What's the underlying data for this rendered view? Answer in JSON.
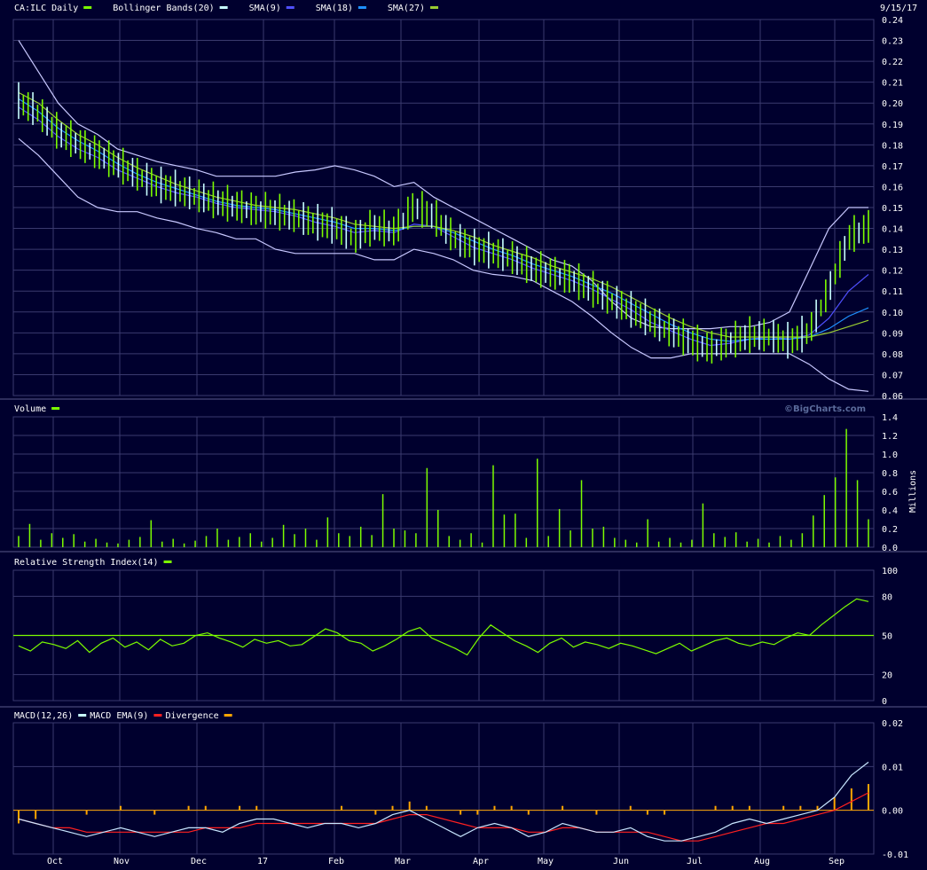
{
  "date_label": "9/15/17",
  "watermark": "©BigCharts.com",
  "colors": {
    "background": "#00002e",
    "grid": "#3a3a6e",
    "price_bar": "#7cfc00",
    "price_bar_alt": "#c8ffff",
    "bollinger": "#c8c8ff",
    "sma9": "#5050ff",
    "sma18": "#1e90ff",
    "sma27": "#9acd32",
    "volume": "#7cfc00",
    "rsi": "#7cfc00",
    "rsi_midline": "#7cfc00",
    "macd": "#c8e6ff",
    "macd_ema": "#ff2020",
    "divergence": "#ffa500"
  },
  "months": [
    "Oct",
    "Nov",
    "Dec",
    "17",
    "Feb",
    "Mar",
    "Apr",
    "May",
    "Jun",
    "Jul",
    "Aug",
    "Sep"
  ],
  "legends": {
    "price": [
      {
        "text": "CA:ILC Daily",
        "color": "#7cfc00"
      },
      {
        "text": "Bollinger Bands(20)",
        "color": "#c8ffff"
      },
      {
        "text": "SMA(9)",
        "color": "#5050ff"
      },
      {
        "text": "SMA(18)",
        "color": "#1e90ff"
      },
      {
        "text": "SMA(27)",
        "color": "#9acd32"
      }
    ],
    "volume": [
      {
        "text": "Volume",
        "color": "#7cfc00"
      }
    ],
    "rsi": [
      {
        "text": "Relative Strength Index(14)",
        "color": "#7cfc00"
      }
    ],
    "macd": [
      {
        "text": "MACD(12,26)",
        "color": "#c8ffff"
      },
      {
        "text": "MACD EMA(9)",
        "color": "#ff2020"
      },
      {
        "text": "Divergence",
        "color": "#ffa500"
      }
    ]
  },
  "chart_data": [
    {
      "type": "line",
      "panel": "price",
      "ylim": [
        0.06,
        0.24
      ],
      "yticks": [
        "0.24",
        "0.23",
        "0.22",
        "0.21",
        "0.20",
        "0.19",
        "0.18",
        "0.17",
        "0.16",
        "0.15",
        "0.14",
        "0.13",
        "0.12",
        "0.11",
        "0.10",
        "0.09",
        "0.08",
        "0.07",
        "0.06"
      ],
      "x_months": [
        "Oct",
        "Nov",
        "Dec",
        "17",
        "Feb",
        "Mar",
        "Apr",
        "May",
        "Jun",
        "Jul",
        "Aug",
        "Sep"
      ],
      "series": [
        {
          "name": "CA:ILC Daily",
          "role": "close",
          "values": [
            0.2,
            0.195,
            0.185,
            0.18,
            0.175,
            0.17,
            0.165,
            0.16,
            0.158,
            0.155,
            0.152,
            0.15,
            0.148,
            0.147,
            0.145,
            0.142,
            0.14,
            0.135,
            0.14,
            0.138,
            0.15,
            0.145,
            0.135,
            0.13,
            0.128,
            0.125,
            0.12,
            0.118,
            0.115,
            0.11,
            0.105,
            0.1,
            0.095,
            0.09,
            0.085,
            0.082,
            0.085,
            0.088,
            0.088,
            0.085,
            0.09,
            0.11,
            0.135,
            0.14
          ]
        },
        {
          "name": "Bollinger Upper",
          "values": [
            0.23,
            0.215,
            0.2,
            0.19,
            0.185,
            0.178,
            0.175,
            0.172,
            0.17,
            0.168,
            0.165,
            0.165,
            0.165,
            0.165,
            0.167,
            0.168,
            0.17,
            0.168,
            0.165,
            0.16,
            0.162,
            0.155,
            0.15,
            0.145,
            0.14,
            0.135,
            0.13,
            0.125,
            0.122,
            0.115,
            0.105,
            0.097,
            0.093,
            0.092,
            0.092,
            0.092,
            0.093,
            0.093,
            0.095,
            0.1,
            0.12,
            0.14,
            0.15,
            0.15
          ]
        },
        {
          "name": "Bollinger Lower",
          "values": [
            0.183,
            0.175,
            0.165,
            0.155,
            0.15,
            0.148,
            0.148,
            0.145,
            0.143,
            0.14,
            0.138,
            0.135,
            0.135,
            0.13,
            0.128,
            0.128,
            0.128,
            0.128,
            0.125,
            0.125,
            0.13,
            0.128,
            0.125,
            0.12,
            0.118,
            0.117,
            0.115,
            0.11,
            0.105,
            0.098,
            0.09,
            0.083,
            0.078,
            0.078,
            0.08,
            0.08,
            0.08,
            0.08,
            0.08,
            0.08,
            0.075,
            0.068,
            0.063,
            0.062
          ]
        },
        {
          "name": "SMA(9)",
          "values": [
            0.198,
            0.192,
            0.184,
            0.178,
            0.174,
            0.168,
            0.164,
            0.16,
            0.157,
            0.155,
            0.152,
            0.15,
            0.149,
            0.148,
            0.146,
            0.143,
            0.141,
            0.138,
            0.139,
            0.138,
            0.142,
            0.141,
            0.136,
            0.131,
            0.128,
            0.125,
            0.121,
            0.118,
            0.115,
            0.111,
            0.106,
            0.101,
            0.095,
            0.091,
            0.087,
            0.084,
            0.085,
            0.087,
            0.088,
            0.087,
            0.089,
            0.097,
            0.11,
            0.118
          ]
        },
        {
          "name": "SMA(18)",
          "values": [
            0.202,
            0.196,
            0.188,
            0.182,
            0.177,
            0.171,
            0.166,
            0.162,
            0.159,
            0.156,
            0.153,
            0.151,
            0.15,
            0.149,
            0.147,
            0.145,
            0.143,
            0.14,
            0.14,
            0.139,
            0.141,
            0.141,
            0.138,
            0.134,
            0.13,
            0.127,
            0.123,
            0.12,
            0.117,
            0.113,
            0.109,
            0.104,
            0.099,
            0.094,
            0.09,
            0.087,
            0.086,
            0.087,
            0.087,
            0.087,
            0.088,
            0.092,
            0.098,
            0.102
          ]
        },
        {
          "name": "SMA(27)",
          "values": [
            0.205,
            0.2,
            0.192,
            0.185,
            0.18,
            0.174,
            0.169,
            0.165,
            0.161,
            0.158,
            0.155,
            0.153,
            0.151,
            0.15,
            0.149,
            0.147,
            0.145,
            0.142,
            0.141,
            0.14,
            0.141,
            0.141,
            0.139,
            0.136,
            0.132,
            0.129,
            0.126,
            0.122,
            0.119,
            0.116,
            0.112,
            0.107,
            0.102,
            0.097,
            0.093,
            0.09,
            0.088,
            0.088,
            0.088,
            0.088,
            0.088,
            0.09,
            0.093,
            0.096
          ]
        }
      ]
    },
    {
      "type": "bar",
      "panel": "volume",
      "ylabel": "Millions",
      "ylim": [
        0,
        1.4
      ],
      "yticks": [
        "1.4",
        "1.2",
        "1.0",
        "0.8",
        "0.6",
        "0.4",
        "0.2",
        "0.0"
      ],
      "values": [
        0.12,
        0.25,
        0.08,
        0.15,
        0.1,
        0.14,
        0.06,
        0.09,
        0.05,
        0.04,
        0.08,
        0.11,
        0.29,
        0.06,
        0.09,
        0.04,
        0.07,
        0.12,
        0.2,
        0.08,
        0.11,
        0.15,
        0.06,
        0.1,
        0.24,
        0.14,
        0.2,
        0.08,
        0.32,
        0.15,
        0.12,
        0.22,
        0.13,
        0.57,
        0.2,
        0.18,
        0.15,
        0.85,
        0.4,
        0.12,
        0.08,
        0.15,
        0.05,
        0.88,
        0.35,
        0.36,
        0.1,
        0.95,
        0.12,
        0.41,
        0.18,
        0.72,
        0.2,
        0.22,
        0.1,
        0.08,
        0.05,
        0.3,
        0.06,
        0.1,
        0.05,
        0.08,
        0.47,
        0.15,
        0.11,
        0.16,
        0.06,
        0.09,
        0.05,
        0.12,
        0.08,
        0.15,
        0.34,
        0.56,
        0.75,
        1.27,
        0.72,
        0.3
      ]
    },
    {
      "type": "line",
      "panel": "rsi",
      "ylim": [
        0,
        100
      ],
      "yticks": [
        "100",
        "80",
        "50",
        "20",
        "0"
      ],
      "midline": 50,
      "values": [
        42,
        38,
        45,
        43,
        40,
        46,
        37,
        44,
        48,
        41,
        45,
        39,
        47,
        42,
        44,
        50,
        52,
        48,
        45,
        41,
        47,
        44,
        46,
        42,
        43,
        49,
        55,
        52,
        46,
        44,
        38,
        42,
        47,
        53,
        56,
        48,
        44,
        40,
        35,
        48,
        58,
        52,
        46,
        42,
        37,
        44,
        48,
        41,
        45,
        43,
        40,
        44,
        42,
        39,
        36,
        40,
        44,
        38,
        42,
        46,
        48,
        44,
        42,
        45,
        43,
        48,
        52,
        50,
        58,
        65,
        72,
        78,
        76
      ]
    },
    {
      "type": "line",
      "panel": "macd",
      "ylim": [
        -0.01,
        0.02
      ],
      "yticks": [
        "0.02",
        "0.01",
        "0.00",
        "-0.01"
      ],
      "series": [
        {
          "name": "MACD(12,26)",
          "values": [
            -0.002,
            -0.003,
            -0.004,
            -0.005,
            -0.006,
            -0.005,
            -0.004,
            -0.005,
            -0.006,
            -0.005,
            -0.004,
            -0.004,
            -0.005,
            -0.003,
            -0.002,
            -0.002,
            -0.003,
            -0.004,
            -0.003,
            -0.003,
            -0.004,
            -0.003,
            -0.001,
            0.0,
            -0.002,
            -0.004,
            -0.006,
            -0.004,
            -0.003,
            -0.004,
            -0.006,
            -0.005,
            -0.003,
            -0.004,
            -0.005,
            -0.005,
            -0.004,
            -0.006,
            -0.007,
            -0.007,
            -0.006,
            -0.005,
            -0.003,
            -0.002,
            -0.003,
            -0.002,
            -0.001,
            0.0,
            0.003,
            0.008,
            0.011
          ]
        },
        {
          "name": "MACD EMA(9)",
          "values": [
            -0.002,
            -0.003,
            -0.004,
            -0.004,
            -0.005,
            -0.005,
            -0.005,
            -0.005,
            -0.005,
            -0.005,
            -0.005,
            -0.004,
            -0.004,
            -0.004,
            -0.003,
            -0.003,
            -0.003,
            -0.003,
            -0.003,
            -0.003,
            -0.003,
            -0.003,
            -0.002,
            -0.001,
            -0.001,
            -0.002,
            -0.003,
            -0.004,
            -0.004,
            -0.004,
            -0.005,
            -0.005,
            -0.004,
            -0.004,
            -0.005,
            -0.005,
            -0.005,
            -0.005,
            -0.006,
            -0.007,
            -0.007,
            -0.006,
            -0.005,
            -0.004,
            -0.003,
            -0.003,
            -0.002,
            -0.001,
            0.0,
            0.002,
            0.004
          ]
        },
        {
          "name": "Divergence",
          "role": "histogram",
          "values": [
            -0.003,
            -0.002,
            0.0,
            0.0,
            -0.001,
            0.0,
            0.001,
            0.0,
            -0.001,
            0.0,
            0.001,
            0.001,
            0.0,
            0.001,
            0.001,
            0.0,
            0.0,
            0.0,
            0.0,
            0.001,
            0.0,
            -0.001,
            0.001,
            0.002,
            0.001,
            0.0,
            -0.001,
            -0.001,
            0.001,
            0.001,
            -0.001,
            0.0,
            0.001,
            0.0,
            -0.001,
            0.0,
            0.001,
            -0.001,
            -0.001,
            0.0,
            0.0,
            0.001,
            0.001,
            0.001,
            0.0,
            0.001,
            0.001,
            0.001,
            0.003,
            0.005,
            0.006
          ]
        }
      ]
    }
  ]
}
